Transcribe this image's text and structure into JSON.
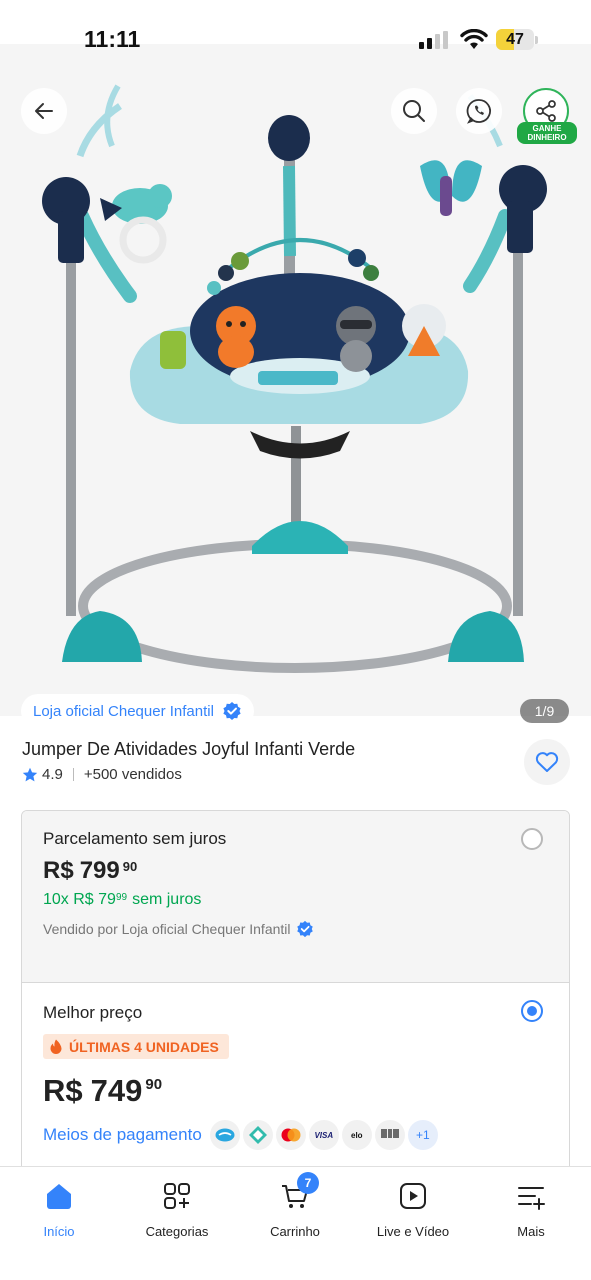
{
  "status_bar": {
    "time": "11:11",
    "battery": "47",
    "battery_level": 0.47
  },
  "gallery": {
    "seller_badge": "Loja oficial Chequer Infantil",
    "counter": "1/9",
    "earn_badge": "GANHE DINHEIRO"
  },
  "product": {
    "title": "Jumper De Atividades Joyful Infanti Verde",
    "rating": "4.9",
    "sold": "+500 vendidos"
  },
  "offers": [
    {
      "label": "Parcelamento sem juros",
      "currency": "R$",
      "price": "799",
      "cents": "90",
      "installments_prefix": "10x R$ 79",
      "installments_cents": "99",
      "installments_suffix": "sem juros",
      "sold_by": "Vendido por Loja oficial Chequer Infantil",
      "selected": false
    },
    {
      "label": "Melhor preço",
      "stock_tag": "ÚLTIMAS 4 UNIDADES",
      "currency": "R$",
      "price": "749",
      "cents": "90",
      "payment_label": "Meios de pagamento",
      "payment_methods": [
        "mercado-pago-icon",
        "pix-icon",
        "mastercard-icon",
        "visa-icon",
        "elo-icon",
        "boleto-icon"
      ],
      "payment_more": "+1",
      "selected": true
    }
  ],
  "bottom_nav": [
    {
      "label": "Início",
      "icon": "home-icon",
      "active": true
    },
    {
      "label": "Categorias",
      "icon": "categories-icon",
      "active": false
    },
    {
      "label": "Carrinho",
      "icon": "cart-icon",
      "active": false,
      "badge": "7"
    },
    {
      "label": "Live e Vídeo",
      "icon": "play-icon",
      "active": false
    },
    {
      "label": "Mais",
      "icon": "more-icon",
      "active": false
    }
  ],
  "colors": {
    "accent": "#3483fa",
    "green": "#00a650",
    "orange": "#f06322",
    "whatsapp_green": "#20a845"
  }
}
